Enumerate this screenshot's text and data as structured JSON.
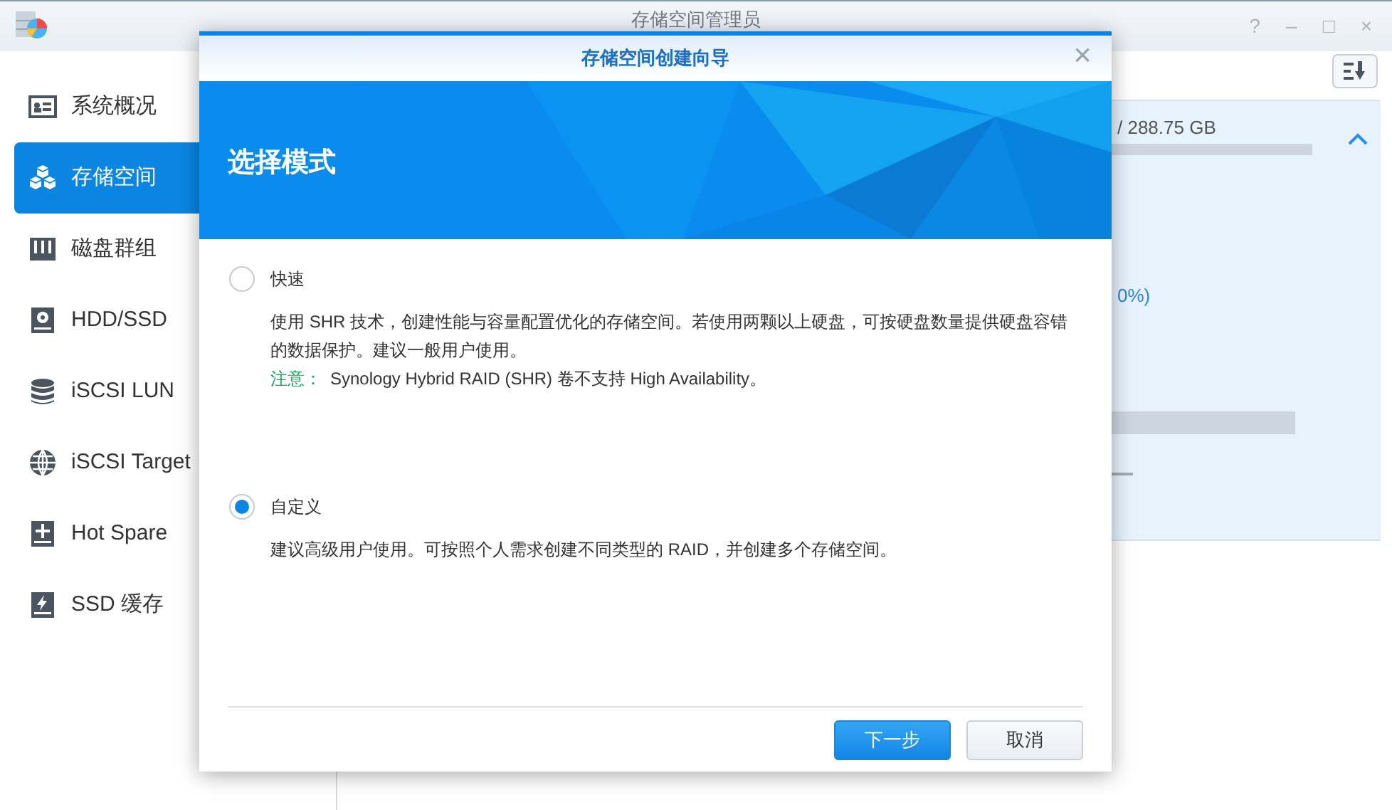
{
  "window": {
    "title": "存储空间管理员",
    "controls": [
      "?",
      "–",
      "□",
      "×"
    ]
  },
  "sidebar": {
    "items": [
      {
        "label": "系统概况",
        "selected": false
      },
      {
        "label": "存储空间",
        "selected": true
      },
      {
        "label": "磁盘群组",
        "selected": false
      },
      {
        "label": "HDD/SSD",
        "selected": false
      },
      {
        "label": "iSCSI LUN",
        "selected": false
      },
      {
        "label": "iSCSI Target",
        "selected": false
      },
      {
        "label": "Hot Spare",
        "selected": false
      },
      {
        "label": "SSD 缓存",
        "selected": false
      }
    ]
  },
  "background_panel": {
    "capacity": "/ 288.75 GB",
    "percent": "0%)",
    "expanded": true
  },
  "dialog": {
    "title": "存储空间创建向导",
    "close": "×",
    "heading": "选择模式",
    "options": [
      {
        "label": "快速",
        "selected": false,
        "description": "使用 SHR 技术，创建性能与容量配置优化的存储空间。若使用两颗以上硬盘，可按硬盘数量提供硬盘容错的数据保护。建议一般用户使用。",
        "note_label": "注意：",
        "note": "Synology Hybrid RAID (SHR) 卷不支持 High Availability。"
      },
      {
        "label": "自定义",
        "selected": true,
        "description": "建议高级用户使用。可按照个人需求创建不同类型的 RAID，并创建多个存储空间。"
      }
    ],
    "buttons": [
      {
        "label": "下一步",
        "kind": "primary"
      },
      {
        "label": "取消",
        "kind": "secondary"
      }
    ]
  }
}
